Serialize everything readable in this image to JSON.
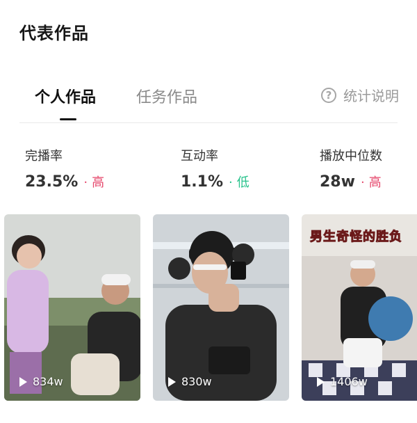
{
  "header": {
    "title": "代表作品"
  },
  "tabs": [
    {
      "label": "个人作品",
      "active": true
    },
    {
      "label": "任务作品",
      "active": false
    }
  ],
  "help": {
    "label": "统计说明",
    "icon": "question-circle-icon"
  },
  "metrics": [
    {
      "label": "完播率",
      "value": "23.5%",
      "level": "高"
    },
    {
      "label": "互动率",
      "value": "1.1%",
      "level": "低"
    },
    {
      "label": "播放中位数",
      "value": "28w",
      "level": "高"
    }
  ],
  "videos": [
    {
      "plays": "834w"
    },
    {
      "plays": "830w"
    },
    {
      "plays": "1406w",
      "banner": "男生奇怪的胜负"
    }
  ],
  "colors": {
    "high": "#e6486c",
    "low": "#27c28b"
  }
}
